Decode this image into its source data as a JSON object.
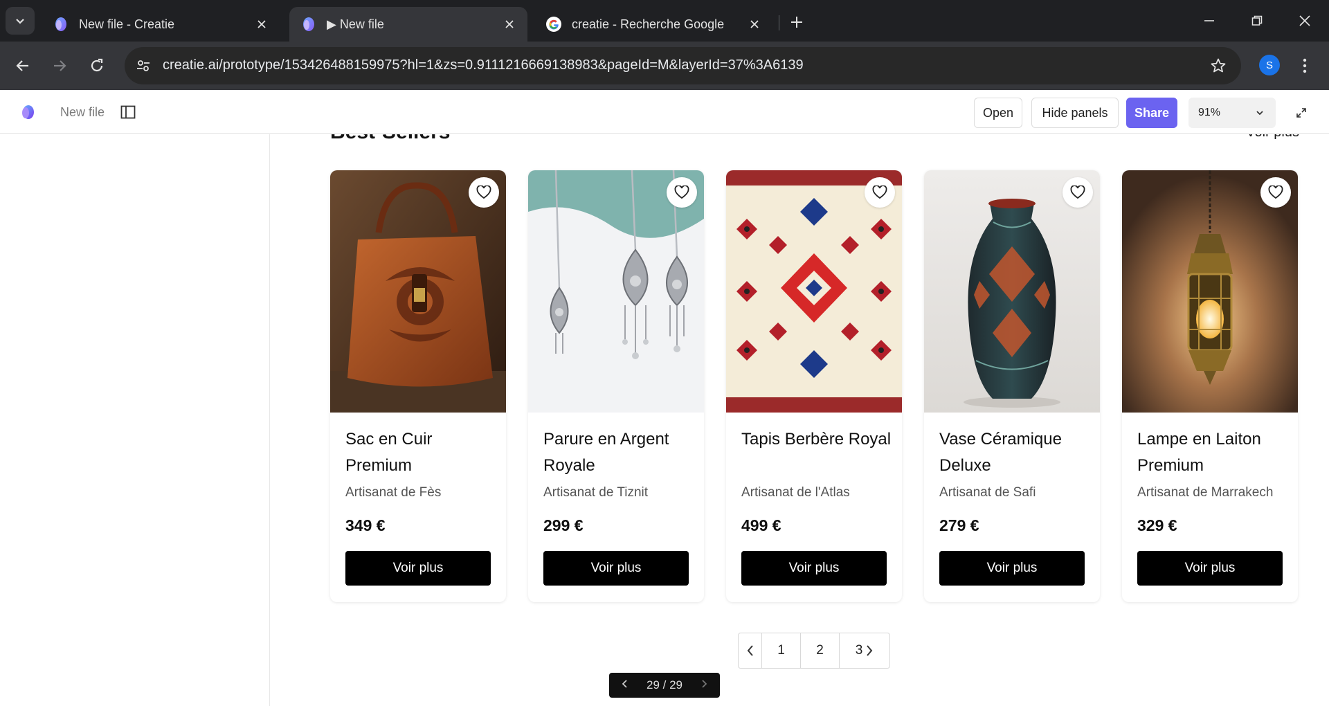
{
  "browser": {
    "tabs": [
      {
        "title": "New file - Creatie",
        "favicon": "creatie-logo-icon",
        "active": false
      },
      {
        "title": "▶ New file",
        "favicon": "creatie-logo-icon",
        "active": true
      },
      {
        "title": "creatie - Recherche Google",
        "favicon": "google-logo-icon",
        "active": false
      }
    ],
    "url": "creatie.ai/prototype/153426488159975?hl=1&zs=0.9111216669138983&pageId=M&layerId=37%3A6139",
    "profile_initial": "S",
    "colors": {
      "tabbar": "#1f2023",
      "active_tab": "#35363a",
      "omnibox": "#282828"
    }
  },
  "app": {
    "file_name": "New file",
    "buttons": {
      "open": "Open",
      "hide_panels": "Hide panels",
      "share": "Share"
    },
    "zoom": "91%",
    "colors": {
      "share": "#6b63f0"
    }
  },
  "section": {
    "title": "Best-Sellers",
    "see_more": "Voir plus"
  },
  "products": [
    {
      "name": "Sac en Cuir Premium",
      "origin": "Artisanat de Fès",
      "price": "349 €",
      "cta": "Voir plus",
      "image": "leather-bag"
    },
    {
      "name": "Parure en Argent Royale",
      "origin": "Artisanat de Tiznit",
      "price": "299 €",
      "cta": "Voir plus",
      "image": "silver-jewelry"
    },
    {
      "name": "Tapis Berbère Royal",
      "origin": "Artisanat de l'Atlas",
      "price": "499 €",
      "cta": "Voir plus",
      "image": "berber-rug"
    },
    {
      "name": "Vase Céramique Deluxe",
      "origin": "Artisanat de Safi",
      "price": "279 €",
      "cta": "Voir plus",
      "image": "ceramic-vase"
    },
    {
      "name": "Lampe en Laiton Premium",
      "origin": "Artisanat de Marrakech",
      "price": "329 €",
      "cta": "Voir plus",
      "image": "brass-lamp"
    }
  ],
  "pagination": {
    "pages": [
      "1",
      "2",
      "3"
    ]
  },
  "prototype_nav": {
    "counter": "29 / 29"
  }
}
